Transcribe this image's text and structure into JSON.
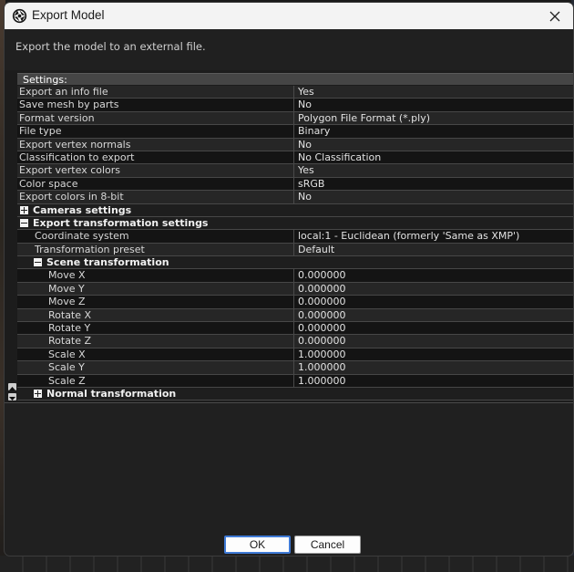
{
  "window": {
    "title": "Export Model",
    "description": "Export the model to an external file."
  },
  "settings_header": "Settings:",
  "rows": [
    {
      "name": "Export an info file",
      "value": "Yes",
      "level": 0
    },
    {
      "name": "Save mesh by parts",
      "value": "No",
      "level": 0
    },
    {
      "name": "Format version",
      "value": "Polygon File Format (*.ply)",
      "level": 0
    },
    {
      "name": "File type",
      "value": "Binary",
      "level": 0
    },
    {
      "name": "Export vertex normals",
      "value": "No",
      "level": 0
    },
    {
      "name": "Classification to export",
      "value": "No Classification",
      "level": 0
    },
    {
      "name": "Export vertex colors",
      "value": "Yes",
      "level": 0
    },
    {
      "name": "Color space",
      "value": "sRGB",
      "level": 0
    },
    {
      "name": "Export colors in 8-bit",
      "value": "No",
      "level": 0
    },
    {
      "name": "Cameras settings",
      "group": true,
      "expanded": false,
      "level": 0
    },
    {
      "name": "Export transformation settings",
      "group": true,
      "expanded": true,
      "level": 0
    },
    {
      "name": "Coordinate system",
      "value": "local:1 - Euclidean (formerly 'Same as XMP')",
      "level": 1
    },
    {
      "name": "Transformation preset",
      "value": "Default",
      "level": 1
    },
    {
      "name": "Scene transformation",
      "group": true,
      "expanded": true,
      "level": 1
    },
    {
      "name": "Move X",
      "value": "0.000000",
      "level": 2
    },
    {
      "name": "Move Y",
      "value": "0.000000",
      "level": 2
    },
    {
      "name": "Move Z",
      "value": "0.000000",
      "level": 2
    },
    {
      "name": "Rotate X",
      "value": "0.000000",
      "level": 2
    },
    {
      "name": "Rotate Y",
      "value": "0.000000",
      "level": 2
    },
    {
      "name": "Rotate Z",
      "value": "0.000000",
      "level": 2
    },
    {
      "name": "Scale X",
      "value": "1.000000",
      "level": 2
    },
    {
      "name": "Scale Y",
      "value": "1.000000",
      "level": 2
    },
    {
      "name": "Scale Z",
      "value": "1.000000",
      "level": 2
    },
    {
      "name": "Normal transformation",
      "group": true,
      "expanded": false,
      "level": 1
    }
  ],
  "buttons": {
    "ok": "OK",
    "cancel": "Cancel"
  },
  "colors": {
    "accent": "#3f7ad6",
    "dialog_bg": "#202020",
    "titlebar_bg": "#f3f3f3"
  },
  "icons": {
    "app": "aperture-icon",
    "close": "close-icon",
    "expand": "plus-box-icon",
    "collapse": "minus-box-icon"
  }
}
